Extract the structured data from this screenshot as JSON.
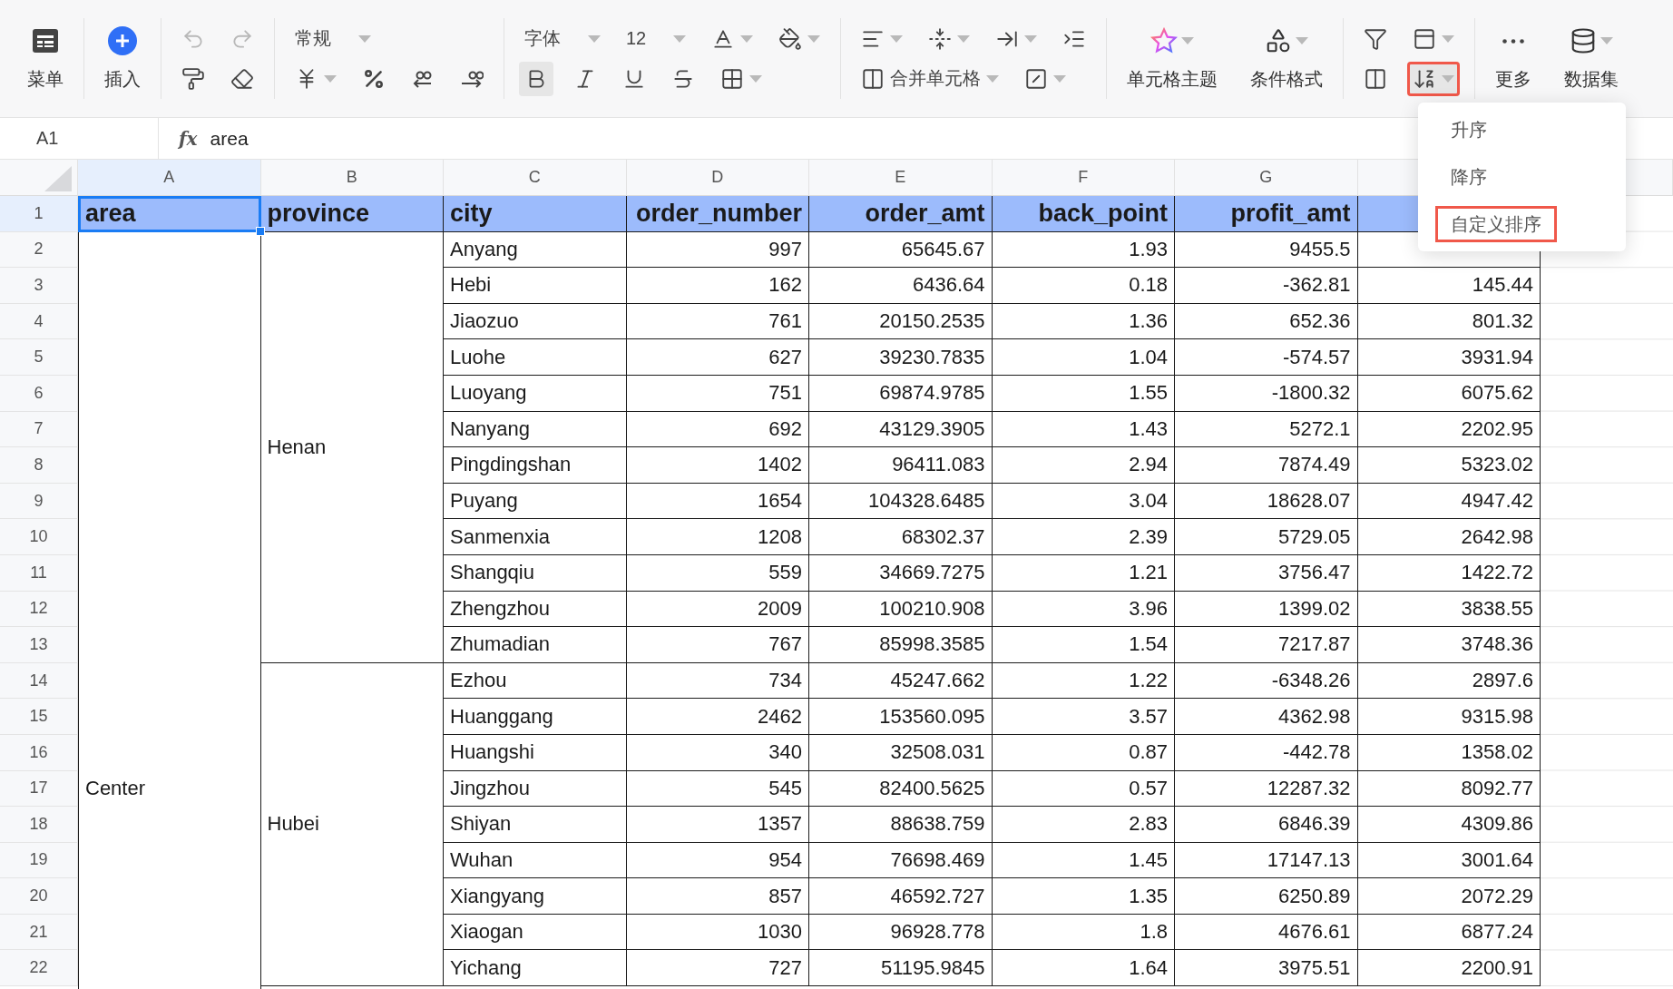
{
  "toolbar": {
    "groups": [
      {
        "kind": "large",
        "items": [
          {
            "kind": "menu",
            "label": "菜单"
          }
        ]
      },
      {
        "kind": "large",
        "items": [
          {
            "kind": "insert",
            "label": "插入"
          }
        ]
      },
      {
        "kind": "rows",
        "rows": [
          [
            {
              "kind": "undo",
              "disabled": true
            },
            {
              "kind": "redo",
              "disabled": true
            }
          ],
          [
            {
              "kind": "painter",
              "disabled": false
            },
            {
              "kind": "eraser",
              "disabled": false
            }
          ]
        ]
      },
      {
        "kind": "rows",
        "rows": [
          [
            {
              "kind": "select",
              "label": "常规",
              "dropdown": true
            }
          ],
          [
            {
              "kind": "yen",
              "dropdown": true
            },
            {
              "kind": "percent"
            },
            {
              "kind": "decimal-less"
            },
            {
              "kind": "decimal-more"
            }
          ]
        ]
      },
      {
        "kind": "rows",
        "rows": [
          [
            {
              "kind": "select",
              "label": "字体",
              "dropdown": true
            },
            {
              "kind": "select",
              "label": "12",
              "dropdown": true
            },
            {
              "kind": "font-color",
              "dropdown": true
            },
            {
              "kind": "fill-color",
              "dropdown": true
            }
          ],
          [
            {
              "kind": "bold",
              "active": true
            },
            {
              "kind": "italic",
              "active": false
            },
            {
              "kind": "underline",
              "active": false
            },
            {
              "kind": "strike",
              "active": false
            },
            {
              "kind": "border",
              "dropdown": true,
              "active": false
            }
          ]
        ]
      },
      {
        "kind": "rows",
        "rows": [
          [
            {
              "kind": "align-left",
              "dropdown": true
            },
            {
              "kind": "valign",
              "dropdown": true
            },
            {
              "kind": "direction",
              "dropdown": true
            },
            {
              "kind": "indent"
            }
          ],
          [
            {
              "kind": "merge",
              "label": "合并单元格",
              "dropdown": true
            },
            {
              "kind": "diagonal",
              "dropdown": true
            }
          ]
        ]
      },
      {
        "kind": "large",
        "items": [
          {
            "kind": "theme",
            "label": "单元格主题",
            "dropdown": true
          },
          {
            "kind": "conditional",
            "label": "条件格式",
            "dropdown": true
          }
        ]
      },
      {
        "kind": "rows",
        "rows": [
          [
            {
              "kind": "filter",
              "highlighted": false
            },
            {
              "kind": "freeze",
              "dropdown": true,
              "highlighted": false
            }
          ],
          [
            {
              "kind": "split",
              "highlighted": false
            },
            {
              "kind": "sort",
              "dropdown": true,
              "highlighted": true
            }
          ]
        ]
      },
      {
        "kind": "large",
        "items": [
          {
            "kind": "more",
            "label": "更多"
          },
          {
            "kind": "dataset",
            "label": "数据集",
            "dropdown": true
          }
        ]
      }
    ]
  },
  "sort_menu": {
    "items": [
      {
        "label": "升序",
        "highlighted": false
      },
      {
        "label": "降序",
        "highlighted": false
      },
      {
        "label": "自定义排序",
        "highlighted": true
      }
    ]
  },
  "formula_bar": {
    "cell": "A1",
    "function_label": "fx",
    "value": "area"
  },
  "sheet": {
    "column_letters": [
      {
        "label": "A",
        "selected": true
      },
      {
        "label": "B",
        "selected": false
      },
      {
        "label": "C",
        "selected": false
      },
      {
        "label": "D",
        "selected": false
      },
      {
        "label": "E",
        "selected": false
      },
      {
        "label": "F",
        "selected": false
      },
      {
        "label": "G",
        "selected": false
      }
    ],
    "row_numbers": [
      {
        "label": "1",
        "selected": true
      },
      {
        "label": "2",
        "selected": false
      },
      {
        "label": "3",
        "selected": false
      },
      {
        "label": "4",
        "selected": false
      },
      {
        "label": "5",
        "selected": false
      },
      {
        "label": "6",
        "selected": false
      },
      {
        "label": "7",
        "selected": false
      },
      {
        "label": "8",
        "selected": false
      },
      {
        "label": "9",
        "selected": false
      },
      {
        "label": "10",
        "selected": false
      },
      {
        "label": "11",
        "selected": false
      },
      {
        "label": "12",
        "selected": false
      },
      {
        "label": "13",
        "selected": false
      },
      {
        "label": "14",
        "selected": false
      },
      {
        "label": "15",
        "selected": false
      },
      {
        "label": "16",
        "selected": false
      },
      {
        "label": "17",
        "selected": false
      },
      {
        "label": "18",
        "selected": false
      },
      {
        "label": "19",
        "selected": false
      },
      {
        "label": "20",
        "selected": false
      },
      {
        "label": "21",
        "selected": false
      },
      {
        "label": "22",
        "selected": false
      }
    ],
    "header": [
      {
        "text": "area",
        "selected": true
      },
      {
        "text": "province",
        "selected": false
      },
      {
        "text": "city",
        "selected": false
      },
      {
        "text": "order_number",
        "selected": false
      },
      {
        "text": "order_amt",
        "selected": false
      },
      {
        "text": "back_point",
        "selected": false
      },
      {
        "text": "profit_amt",
        "selected": false
      }
    ],
    "areas": [
      {
        "name": "Center",
        "continues_below": true,
        "provinces": [
          {
            "name": "Henan",
            "cities": [
              {
                "name": "Anyang",
                "values": [
                  "997",
                  "65645.67",
                  "1.93",
                  "9455.5"
                ]
              },
              {
                "name": "Hebi",
                "values": [
                  "162",
                  "6436.64",
                  "0.18",
                  "-362.81",
                  "145.44"
                ]
              },
              {
                "name": "Jiaozuo",
                "values": [
                  "761",
                  "20150.2535",
                  "1.36",
                  "652.36",
                  "801.32"
                ]
              },
              {
                "name": "Luohe",
                "values": [
                  "627",
                  "39230.7835",
                  "1.04",
                  "-574.57",
                  "3931.94"
                ]
              },
              {
                "name": "Luoyang",
                "values": [
                  "751",
                  "69874.9785",
                  "1.55",
                  "-1800.32",
                  "6075.62"
                ]
              },
              {
                "name": "Nanyang",
                "values": [
                  "692",
                  "43129.3905",
                  "1.43",
                  "5272.1",
                  "2202.95"
                ]
              },
              {
                "name": "Pingdingshan",
                "values": [
                  "1402",
                  "96411.083",
                  "2.94",
                  "7874.49",
                  "5323.02"
                ]
              },
              {
                "name": "Puyang",
                "values": [
                  "1654",
                  "104328.6485",
                  "3.04",
                  "18628.07",
                  "4947.42"
                ]
              },
              {
                "name": "Sanmenxia",
                "values": [
                  "1208",
                  "68302.37",
                  "2.39",
                  "5729.05",
                  "2642.98"
                ]
              },
              {
                "name": "Shangqiu",
                "values": [
                  "559",
                  "34669.7275",
                  "1.21",
                  "3756.47",
                  "1422.72"
                ]
              },
              {
                "name": "Zhengzhou",
                "values": [
                  "2009",
                  "100210.908",
                  "3.96",
                  "1399.02",
                  "3838.55"
                ]
              },
              {
                "name": "Zhumadian",
                "values": [
                  "767",
                  "85998.3585",
                  "1.54",
                  "7217.87",
                  "3748.36"
                ]
              }
            ]
          },
          {
            "name": "Hubei",
            "cities": [
              {
                "name": "Ezhou",
                "values": [
                  "734",
                  "45247.662",
                  "1.22",
                  "-6348.26",
                  "2897.6"
                ]
              },
              {
                "name": "Huanggang",
                "values": [
                  "2462",
                  "153560.095",
                  "3.57",
                  "4362.98",
                  "9315.98"
                ]
              },
              {
                "name": "Huangshi",
                "values": [
                  "340",
                  "32508.031",
                  "0.87",
                  "-442.78",
                  "1358.02"
                ]
              },
              {
                "name": "Jingzhou",
                "values": [
                  "545",
                  "82400.5625",
                  "0.57",
                  "12287.32",
                  "8092.77"
                ]
              },
              {
                "name": "Shiyan",
                "values": [
                  "1357",
                  "88638.759",
                  "2.83",
                  "6846.39",
                  "4309.86"
                ]
              },
              {
                "name": "Wuhan",
                "values": [
                  "954",
                  "76698.469",
                  "1.45",
                  "17147.13",
                  "3001.64"
                ]
              },
              {
                "name": "Xiangyang",
                "values": [
                  "857",
                  "46592.727",
                  "1.35",
                  "6250.89",
                  "2072.29"
                ]
              },
              {
                "name": "Xiaogan",
                "values": [
                  "1030",
                  "96928.778",
                  "1.8",
                  "4676.61",
                  "6877.24"
                ]
              },
              {
                "name": "Yichang",
                "values": [
                  "727",
                  "51195.9845",
                  "1.64",
                  "3975.51",
                  "2200.91"
                ]
              }
            ]
          }
        ]
      }
    ]
  }
}
